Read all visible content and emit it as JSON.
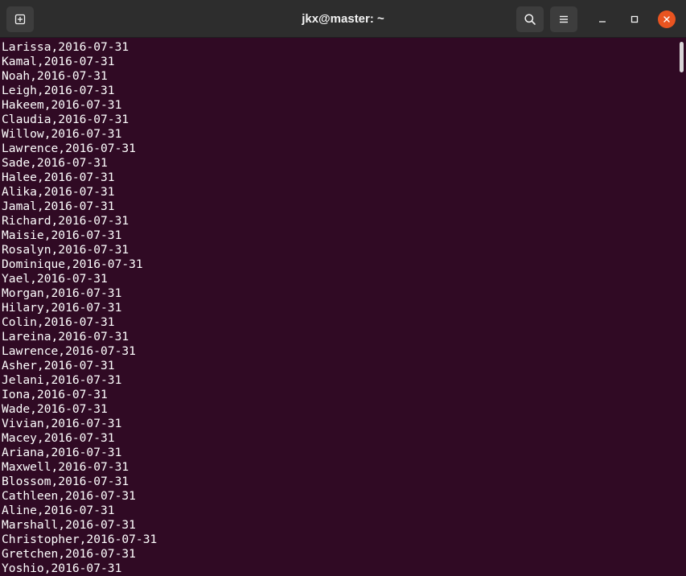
{
  "window": {
    "title": "jkx@master: ~"
  },
  "headerbar": {
    "new_tab_icon": "new-tab-icon",
    "search_icon": "search-icon",
    "menu_icon": "hamburger-menu-icon",
    "minimize_icon": "minimize-icon",
    "maximize_icon": "maximize-icon",
    "close_icon": "close-icon",
    "close_color": "#e95420"
  },
  "terminal": {
    "background_color": "#300a24",
    "text_color": "#ffffff",
    "lines": [
      "Larissa,2016-07-31",
      "Kamal,2016-07-31",
      "Noah,2016-07-31",
      "Leigh,2016-07-31",
      "Hakeem,2016-07-31",
      "Claudia,2016-07-31",
      "Willow,2016-07-31",
      "Lawrence,2016-07-31",
      "Sade,2016-07-31",
      "Halee,2016-07-31",
      "Alika,2016-07-31",
      "Jamal,2016-07-31",
      "Richard,2016-07-31",
      "Maisie,2016-07-31",
      "Rosalyn,2016-07-31",
      "Dominique,2016-07-31",
      "Yael,2016-07-31",
      "Morgan,2016-07-31",
      "Hilary,2016-07-31",
      "Colin,2016-07-31",
      "Lareina,2016-07-31",
      "Lawrence,2016-07-31",
      "Asher,2016-07-31",
      "Jelani,2016-07-31",
      "Iona,2016-07-31",
      "Wade,2016-07-31",
      "Vivian,2016-07-31",
      "Macey,2016-07-31",
      "Ariana,2016-07-31",
      "Maxwell,2016-07-31",
      "Blossom,2016-07-31",
      "Cathleen,2016-07-31",
      "Aline,2016-07-31",
      "Marshall,2016-07-31",
      "Christopher,2016-07-31",
      "Gretchen,2016-07-31",
      "Yoshio,2016-07-31"
    ]
  }
}
